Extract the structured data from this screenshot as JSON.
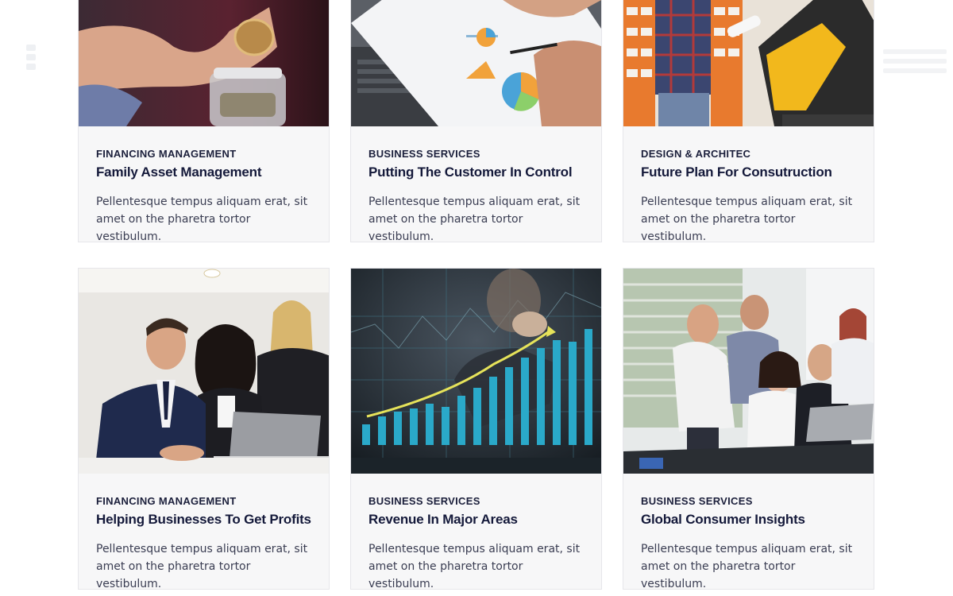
{
  "cards": [
    {
      "category": "FINANCING MANAGEMENT",
      "title": "Family Asset Management",
      "description": "Pellentesque tempus aliquam erat, sit amet on the pharetra tortor vestibulum.",
      "image_icon": "coin-jar-photo"
    },
    {
      "category": "BUSINESS SERVICES",
      "title": "Putting The Customer In Control",
      "description": "Pellentesque tempus aliquam erat, sit amet on the pharetra tortor vestibulum.",
      "image_icon": "charts-clipboard-photo"
    },
    {
      "category": "DESIGN & ARCHITEC",
      "title": "Future Plan  For Consutruction",
      "description": "Pellentesque tempus aliquam erat, sit amet on the pharetra tortor vestibulum.",
      "image_icon": "construction-site-photo"
    },
    {
      "category": "FINANCING MANAGEMENT",
      "title": "Helping Businesses To Get  Profits",
      "description": "Pellentesque tempus aliquam erat, sit amet on the pharetra tortor vestibulum.",
      "image_icon": "business-team-laptop-photo"
    },
    {
      "category": "BUSINESS SERVICES",
      "title": "Revenue In Major Areas",
      "description": "Pellentesque tempus aliquam erat, sit amet on the pharetra tortor vestibulum.",
      "image_icon": "growth-chart-photo"
    },
    {
      "category": "BUSINESS SERVICES",
      "title": "Global Consumer Insights",
      "description": "Pellentesque tempus aliquam erat, sit amet on the pharetra tortor vestibulum.",
      "image_icon": "meeting-room-photo"
    }
  ],
  "colors": {
    "card_bg": "#f7f7f8",
    "title": "#14193a",
    "text": "#3a3d52",
    "chart_accent": "#2aa9c9"
  }
}
